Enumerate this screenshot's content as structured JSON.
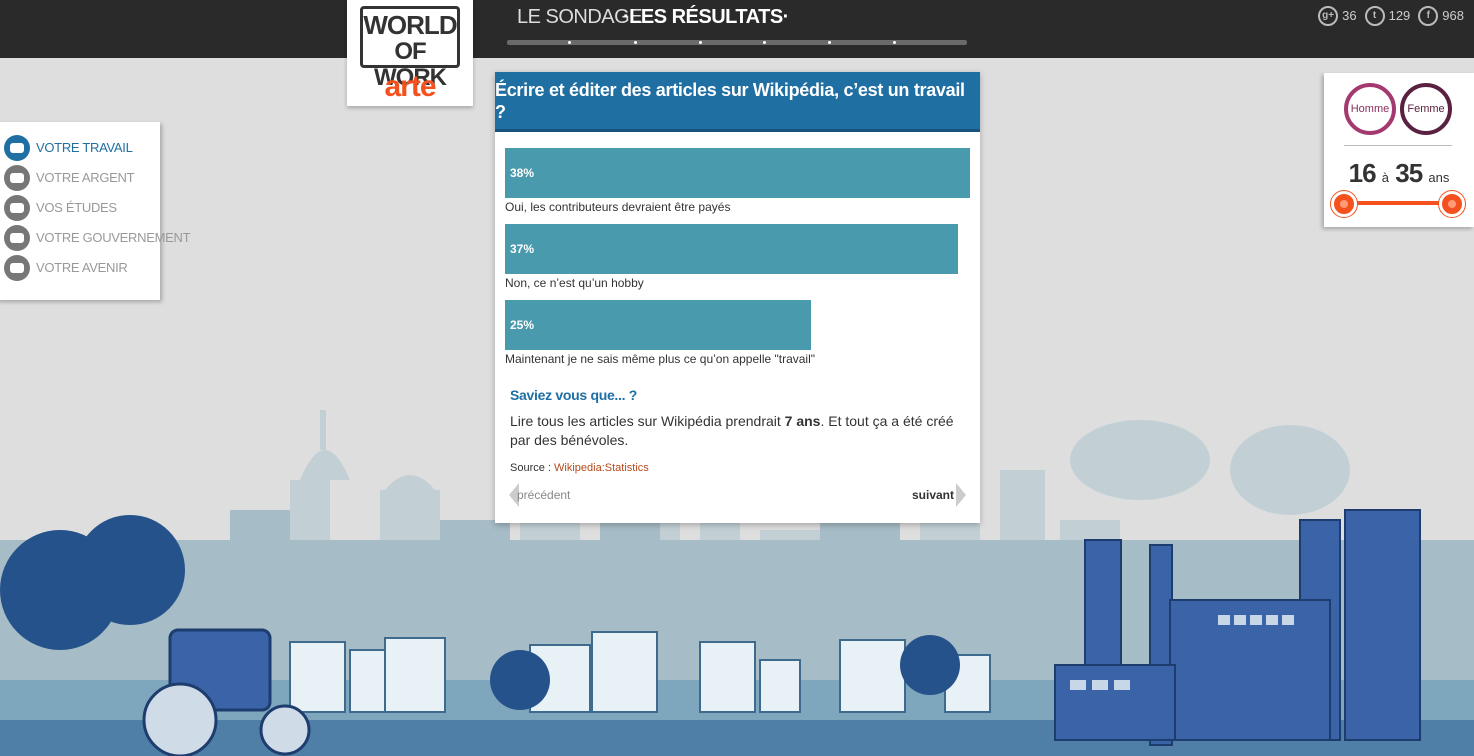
{
  "logo": {
    "line1": "WORLD",
    "line2": "OF WORK",
    "brand": "arte"
  },
  "nav": {
    "tabs": [
      {
        "label": "LE SONDAGE"
      },
      {
        "label": "·LES RÉSULTATS·"
      }
    ]
  },
  "social": {
    "googleplus": {
      "icon": "google-plus-icon",
      "count": "36"
    },
    "twitter": {
      "icon": "twitter-icon",
      "count": "129"
    },
    "facebook": {
      "icon": "facebook-icon",
      "count": "968"
    }
  },
  "side_menu": {
    "items": [
      {
        "label": "VOTRE TRAVAIL",
        "icon": "briefcase-icon",
        "active": true
      },
      {
        "label": "VOTRE ARGENT",
        "icon": "money-icon",
        "active": false
      },
      {
        "label": "VOS ÉTUDES",
        "icon": "graduation-icon",
        "active": false
      },
      {
        "label": "VOTRE GOUVERNEMENT",
        "icon": "government-icon",
        "active": false
      },
      {
        "label": "VOTRE AVENIR",
        "icon": "rocket-icon",
        "active": false
      }
    ]
  },
  "filter": {
    "homme": "Homme",
    "femme": "Femme",
    "age_min": "16",
    "age_sep": "à",
    "age_max": "35",
    "age_unit": "ans",
    "accent": "#f4511e"
  },
  "question": {
    "title": "Écrire et éditer des articles sur Wikipédia, c’est un travail ?",
    "answers": [
      {
        "percent_label": "38%",
        "percent": 38,
        "label": "Oui, les contributeurs devraient être payés"
      },
      {
        "percent_label": "37%",
        "percent": 37,
        "label": "Non, ce n’est qu’un hobby"
      },
      {
        "percent_label": "25%",
        "percent": 25,
        "label": "Maintenant je ne sais même plus ce qu’on appelle \"travail\""
      }
    ]
  },
  "fact": {
    "title": "Saviez vous que... ?",
    "body_before": "Lire tous les articles sur Wikipédia prendrait ",
    "body_bold": "7 ans",
    "body_after": ". Et tout ça a été créé par des bénévoles.",
    "source_label": "Source : ",
    "source_link": "Wikipedia:Statistics"
  },
  "pager": {
    "prev": "précédent",
    "next": "suivant"
  },
  "colors": {
    "primary": "#1f6fa3",
    "bar": "#4a9aad",
    "topbar": "#2a2a2a"
  }
}
